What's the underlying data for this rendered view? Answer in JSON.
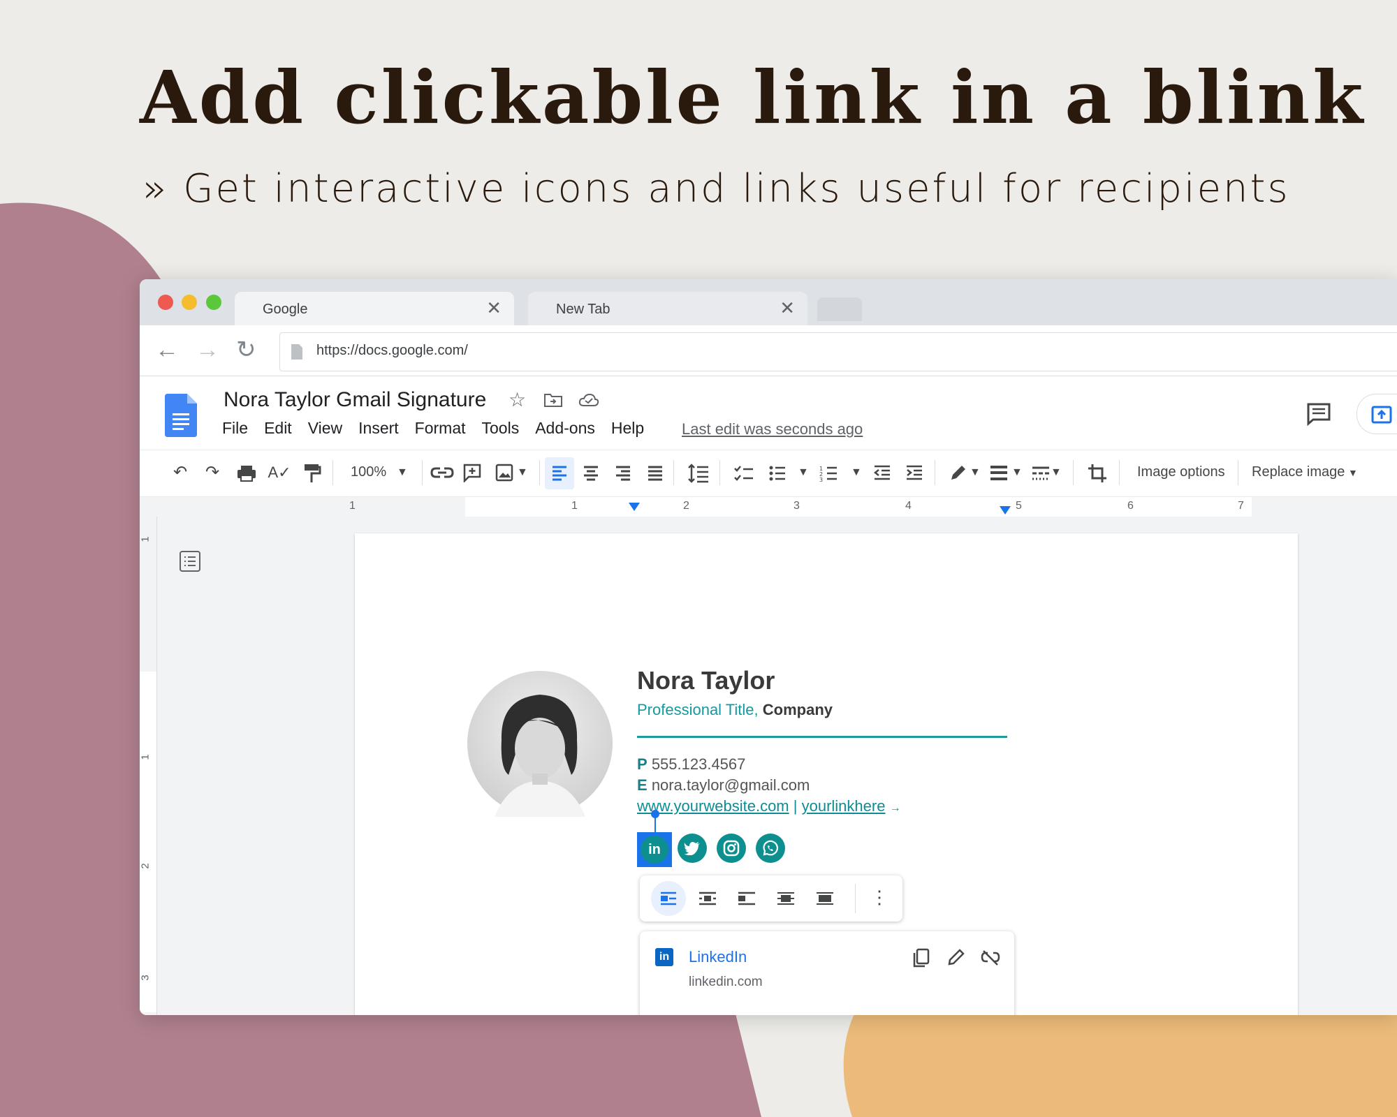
{
  "headline": "Add clickable link in a blink",
  "subline": "» Get interactive icons and links useful for recipients",
  "colors": {
    "background": "#edece8",
    "blob_mauve": "#b0808e",
    "blob_orange": "#ecbb7a",
    "headline": "#2a1a0e",
    "accent_teal": "#129aa0",
    "docs_blue": "#1a73e8"
  },
  "browser": {
    "tabs": [
      {
        "label": "Google",
        "close": "✕"
      },
      {
        "label": "New Tab",
        "close": "✕"
      }
    ],
    "url": "https://docs.google.com/"
  },
  "docs": {
    "title": "Nora Taylor Gmail Signature",
    "menu": [
      "File",
      "Edit",
      "View",
      "Insert",
      "Format",
      "Tools",
      "Add-ons",
      "Help"
    ],
    "last_edit": "Last edit was seconds ago",
    "zoom": "100%",
    "image_options": "Image options",
    "replace_image": "Replace image",
    "ruler_numbers": [
      "1",
      "1",
      "2",
      "3",
      "4",
      "5",
      "6",
      "7"
    ],
    "vruler_numbers": [
      "1",
      "1",
      "2",
      "3"
    ]
  },
  "signature": {
    "name": "Nora Taylor",
    "title": "Professional Title,",
    "company": "Company",
    "phone_label": "P",
    "phone": "555.123.4567",
    "email_label": "E",
    "email": "nora.taylor@gmail.com",
    "website": "www.yourwebsite.com",
    "separator": "|",
    "link": "yourlinkhere",
    "social_icons": [
      "linkedin-icon",
      "twitter-icon",
      "instagram-icon",
      "whatsapp-icon"
    ]
  },
  "link_card": {
    "title": "LinkedIn",
    "url": "linkedin.com"
  }
}
